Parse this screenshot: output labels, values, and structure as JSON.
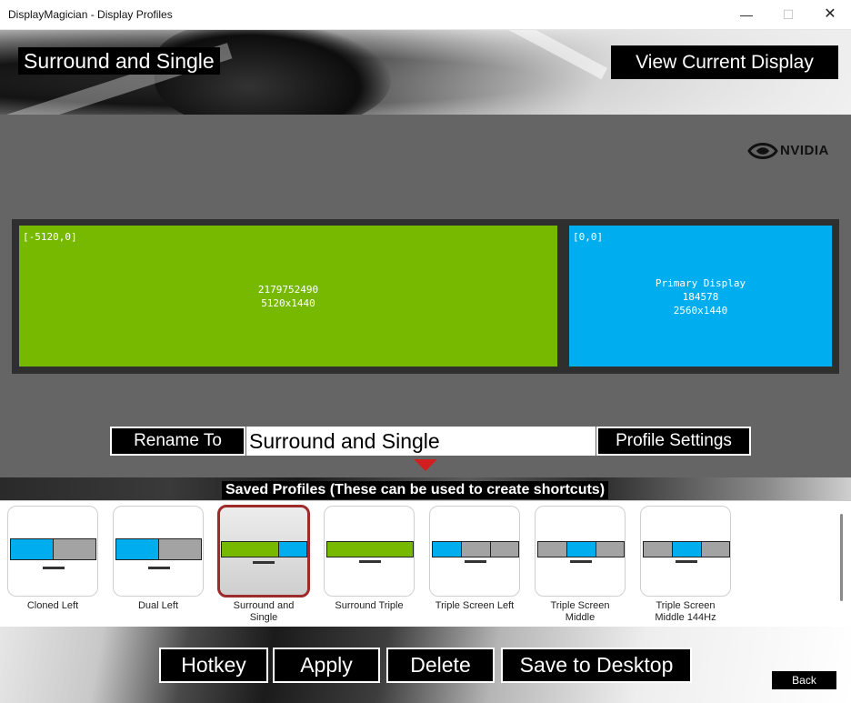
{
  "window": {
    "title": "DisplayMagician - Display Profiles",
    "minimize_glyph": "—",
    "maximize_glyph": "☐",
    "close_glyph": "✕"
  },
  "header": {
    "profile_title": "Surround and Single",
    "view_current_label": "View Current Display"
  },
  "brand": {
    "logo_text": "NVIDIA",
    "green": "#76b900",
    "blue": "#00adef"
  },
  "displays": [
    {
      "coords": "[-5120,0]",
      "lines": [
        "2179752490",
        "5120x1440"
      ]
    },
    {
      "coords": "[0,0]",
      "lines": [
        "Primary Display",
        "184578",
        "2560x1440"
      ]
    }
  ],
  "rename": {
    "label": "Rename To",
    "value": "Surround and Single",
    "profile_settings_label": "Profile Settings"
  },
  "saved_profiles": {
    "heading": "Saved Profiles (These can be used to create shortcuts)",
    "items": [
      {
        "label": "Cloned Left"
      },
      {
        "label": "Dual Left"
      },
      {
        "label": "Surround and Single",
        "selected": true
      },
      {
        "label": "Surround Triple"
      },
      {
        "label": "Triple Screen Left"
      },
      {
        "label": "Triple Screen Middle"
      },
      {
        "label": "Triple Screen Middle 144Hz"
      }
    ]
  },
  "actions": {
    "hotkey": "Hotkey",
    "apply": "Apply",
    "delete": "Delete",
    "save_to_desktop": "Save to Desktop",
    "back": "Back"
  }
}
